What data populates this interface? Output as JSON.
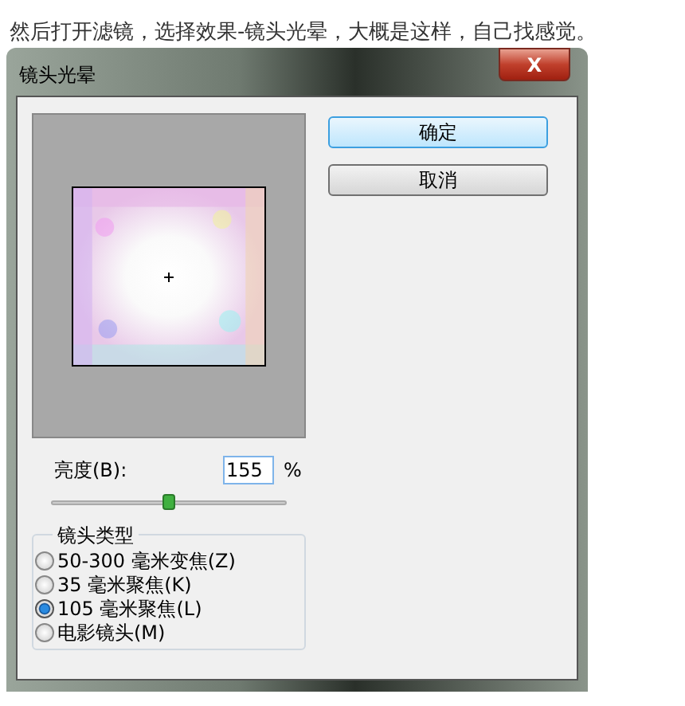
{
  "caption": "然后打开滤镜，选择效果-镜头光晕，大概是这样，自己找感觉。",
  "window": {
    "title": "镜头光晕",
    "close": "X"
  },
  "buttons": [
    {
      "label": "确定",
      "default": true
    },
    {
      "label": "取消",
      "default": false
    }
  ],
  "brightness": {
    "label": "亮度(B):",
    "value": "155",
    "unit": "%",
    "level": 0.5
  },
  "lens_type": {
    "title": "镜头类型",
    "options": [
      {
        "label": "50-300 毫米变焦(Z)",
        "selected": false
      },
      {
        "label": "35 毫米聚焦(K)",
        "selected": false
      },
      {
        "label": "105 毫米聚焦(L)",
        "selected": true
      },
      {
        "label": "电影镜头(M)",
        "selected": false
      }
    ]
  }
}
